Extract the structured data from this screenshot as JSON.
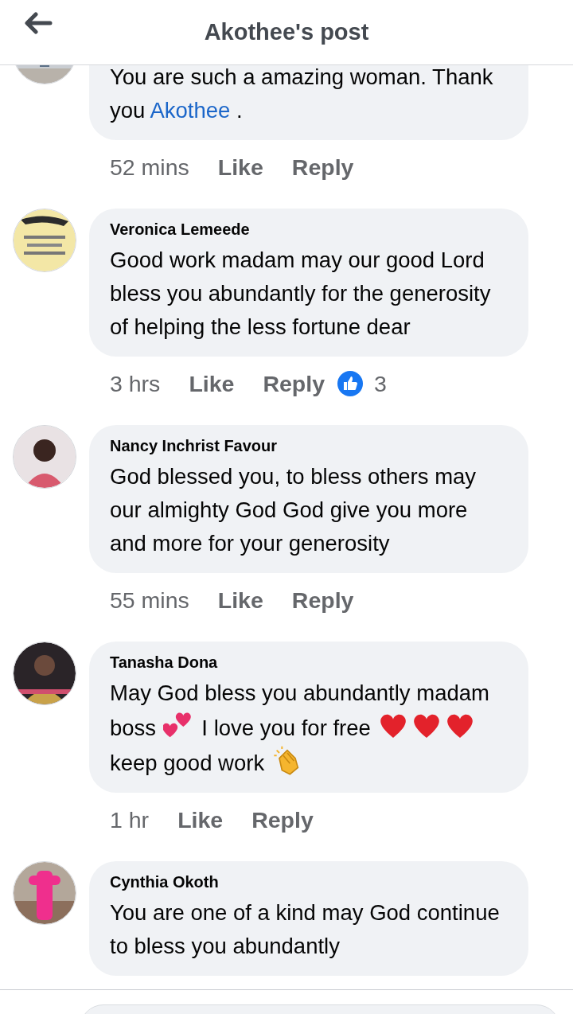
{
  "header": {
    "title": "Akothee's post"
  },
  "comments": [
    {
      "parts": [
        {
          "kind": "text",
          "text": "You are such a amazing woman. Thank you "
        },
        {
          "kind": "mention",
          "text": "Akothee"
        },
        {
          "kind": "text",
          "text": " ."
        }
      ],
      "time": "52 mins",
      "like": "Like",
      "reply": "Reply"
    },
    {
      "name": "Veronica Lemeede",
      "parts": [
        {
          "kind": "text",
          "text": "Good work madam may our good Lord bless you abundantly  for the generosity of helping the less fortune dear"
        }
      ],
      "time": "3 hrs",
      "like": "Like",
      "reply": "Reply",
      "reactions": "3"
    },
    {
      "name": "Nancy Inchrist Favour",
      "parts": [
        {
          "kind": "text",
          "text": "God blessed you, to bless others may our almighty God God give you more and more for your generosity"
        }
      ],
      "time": "55 mins",
      "like": "Like",
      "reply": "Reply"
    },
    {
      "name": "Tanasha Dona",
      "parts": [
        {
          "kind": "text",
          "text": "May God bless you abundantly madam boss "
        },
        {
          "kind": "hearts"
        },
        {
          "kind": "text",
          "text": " I love you for free "
        },
        {
          "kind": "heart"
        },
        {
          "kind": "heart"
        },
        {
          "kind": "heart"
        },
        {
          "kind": "text",
          "text": " keep good work "
        },
        {
          "kind": "clap"
        }
      ],
      "time": "1 hr",
      "like": "Like",
      "reply": "Reply"
    },
    {
      "name": "Cynthia Okoth",
      "parts": [
        {
          "kind": "text",
          "text": "You are one of a kind may God continue to bless you abundantly"
        }
      ]
    }
  ]
}
